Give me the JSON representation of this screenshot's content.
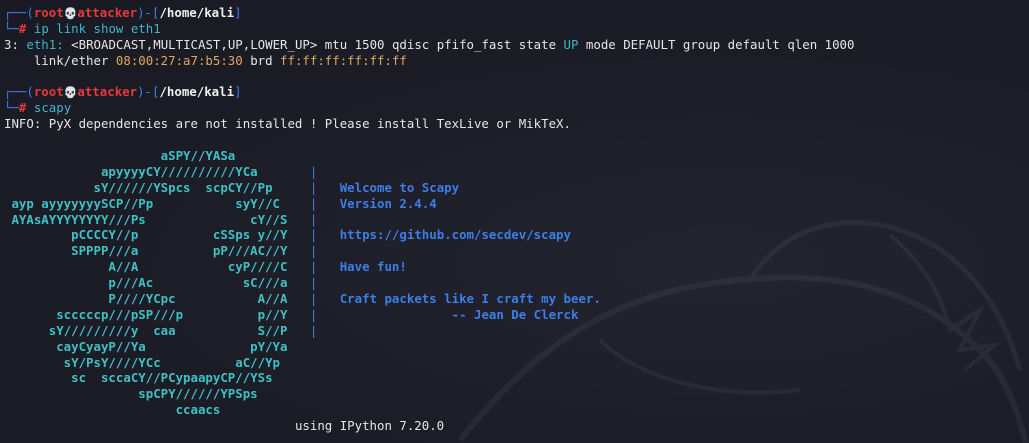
{
  "prompt1": {
    "user": "root",
    "skull": "💀",
    "host": "attacker",
    "path": "/home/kali",
    "command": "ip link show eth1"
  },
  "output1": {
    "index": "3:",
    "iface": "eth1:",
    "flags": "<BROADCAST,MULTICAST,UP,LOWER_UP> mtu 1500 qdisc pfifo_fast state ",
    "state": "UP",
    "rest": " mode DEFAULT group default qlen 1000",
    "link_prefix": "    link/ether ",
    "mac": "08:00:27:a7:b5:30",
    "brd_label": " brd ",
    "brd_mac": "ff:ff:ff:ff:ff:ff"
  },
  "prompt2": {
    "user": "root",
    "skull": "💀",
    "host": "attacker",
    "path": "/home/kali",
    "command": "scapy"
  },
  "info_line": "INFO: PyX dependencies are not installed ! Please install TexLive or MikTeX.",
  "banner_art": [
    "                     aSPY//YASa",
    "             apyyyyCY//////////YCa",
    "            sY//////YSpcs  scpCY//Pp",
    " ayp ayyyyyyySCP//Pp           syY//C",
    " AYAsAYYYYYYYY///Ps              cY//S",
    "         pCCCCY//p          cSSps y//Y",
    "         SPPPP///a          pP///AC//Y",
    "              A//A            cyP////C",
    "              p///Ac            sC///a",
    "              P////YCpc           A//A",
    "       scccccp///pSP///p          p//Y",
    "      sY/////////y  caa           S//P",
    "       cayCyayP//Ya              pY/Ya",
    "        sY/PsY////YCc          aC//Yp",
    "         sc  sccaCY//PCypaapyCP//YSs",
    "                  spCPY//////YPSps",
    "                       ccaacs"
  ],
  "banner_text": [
    "",
    "",
    "Welcome to Scapy",
    "Version 2.4.4",
    "",
    "https://github.com/secdev/scapy",
    "",
    "Have fun!",
    "",
    "Craft packets like I craft my beer.",
    "               -- Jean De Clerck",
    "",
    "",
    "",
    "",
    "",
    ""
  ],
  "ipython_line": "using IPython 7.20.0",
  "colors": {
    "background": "#1b1c26",
    "prompt_frame": "#3d7ee8",
    "user_host": "#e8393a",
    "art": "#3fc1c4",
    "banner_text": "#3d7ee8",
    "mac": "#e0a85a"
  }
}
